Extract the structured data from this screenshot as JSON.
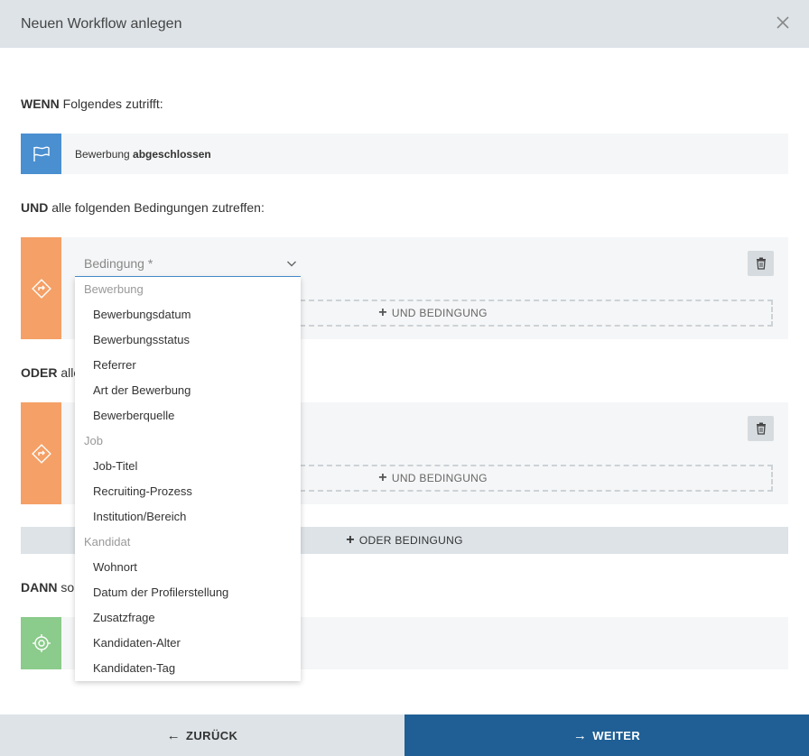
{
  "dialog": {
    "title": "Neuen Workflow anlegen"
  },
  "wenn": {
    "keyword": "WENN",
    "rest": " Folgendes zutrifft:",
    "trigger": {
      "text": "Bewerbung ",
      "bold": "abgeschlossen"
    }
  },
  "und": {
    "keyword": "UND",
    "rest": " alle folgenden Bedingungen zutreffen:"
  },
  "oder": {
    "keyword": "ODER",
    "rest": " alle"
  },
  "dann": {
    "keyword": "DANN",
    "rest": " so"
  },
  "condition": {
    "placeholder": "Bedingung *",
    "add_and_label": "UND BEDINGUNG",
    "add_or_label": "ODER BEDINGUNG"
  },
  "dropdown": {
    "groups": [
      {
        "label": "Bewerbung",
        "items": [
          "Bewerbungsdatum",
          "Bewerbungsstatus",
          "Referrer",
          "Art der Bewerbung",
          "Bewerberquelle"
        ]
      },
      {
        "label": "Job",
        "items": [
          "Job-Titel",
          "Recruiting-Prozess",
          "Institution/Bereich"
        ]
      },
      {
        "label": "Kandidat",
        "items": [
          "Wohnort",
          "Datum der Profilerstellung",
          "Zusatzfrage",
          "Kandidaten-Alter",
          "Kandidaten-Tag"
        ]
      }
    ]
  },
  "footer": {
    "back_label": "ZURÜCK",
    "next_label": "WEITER"
  },
  "colors": {
    "trigger": "#4a8fd0",
    "condition": "#f5a066",
    "action": "#8bcb8b",
    "primary": "#1f5f95"
  },
  "icons": {
    "close": "close-icon",
    "trigger": "flag-icon",
    "condition": "diamond-arrow-icon",
    "delete": "trash-icon",
    "action": "target-icon",
    "back": "arrow-left-icon",
    "next": "arrow-right-icon",
    "select": "chevron-down-icon"
  }
}
